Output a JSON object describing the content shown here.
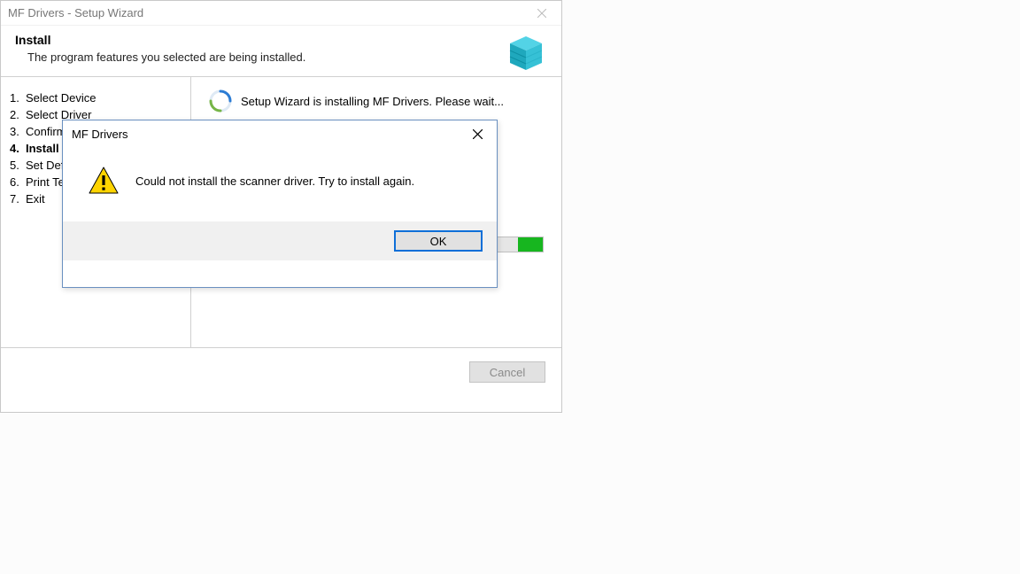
{
  "wizard": {
    "title": "MF Drivers - Setup Wizard",
    "header_title": "Install",
    "header_subtitle": "The program features you selected are being installed.",
    "steps": [
      "Select Device",
      "Select Driver",
      "Confirm Settings",
      "Install",
      "Set Default Printer",
      "Print Test Page",
      "Exit"
    ],
    "current_step_index": 3,
    "progress_text": "Setup Wizard is installing MF Drivers. Please wait...",
    "cancel_label": "Cancel"
  },
  "modal": {
    "title": "MF Drivers",
    "message": "Could not install the scanner driver. Try to install again.",
    "ok_label": "OK"
  }
}
